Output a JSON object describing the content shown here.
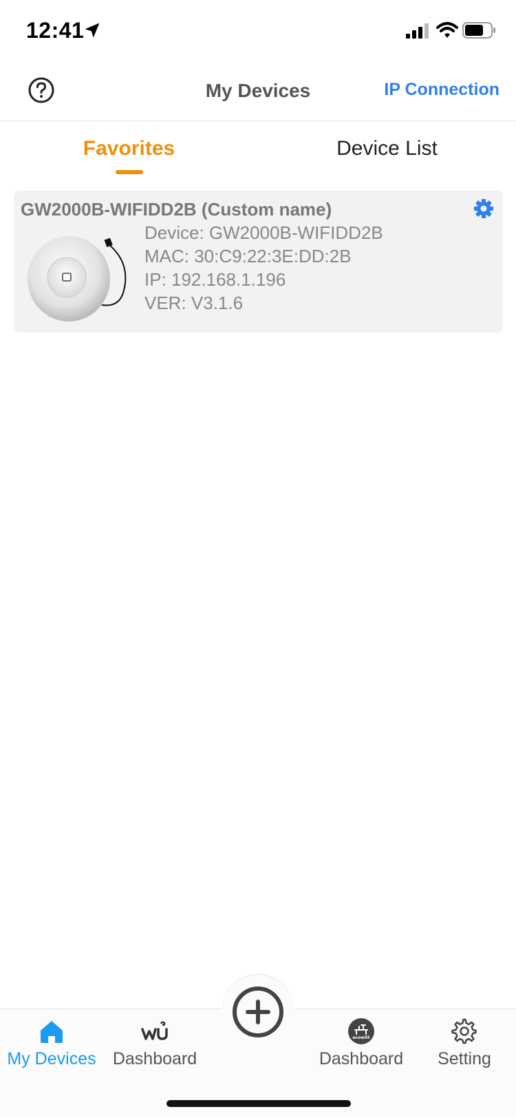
{
  "status_bar": {
    "time": "12:41"
  },
  "nav": {
    "title": "My Devices",
    "ip_connection_label": "IP Connection"
  },
  "tabs": {
    "favorites_label": "Favorites",
    "device_list_label": "Device List"
  },
  "device_card": {
    "name": "GW2000B-WIFIDD2B (Custom name)",
    "device_line": "Device: GW2000B-WIFIDD2B",
    "mac_line": "MAC: 30:C9:22:3E:DD:2B",
    "ip_line": "IP: 192.168.1.196",
    "ver_line": "VER: V3.1.6"
  },
  "tabbar": {
    "items": [
      {
        "label": "My Devices",
        "icon": "home-icon",
        "active": true
      },
      {
        "label": "Dashboard",
        "icon": "wu-icon",
        "active": false
      },
      {
        "label": "Dashboard",
        "icon": "ecowitt-icon",
        "active": false
      },
      {
        "label": "Setting",
        "icon": "gear-icon",
        "active": false
      }
    ]
  },
  "colors": {
    "accent_orange": "#f0900a",
    "link_blue": "#2f7ff0",
    "active_tab_blue": "#1a9bf0"
  }
}
